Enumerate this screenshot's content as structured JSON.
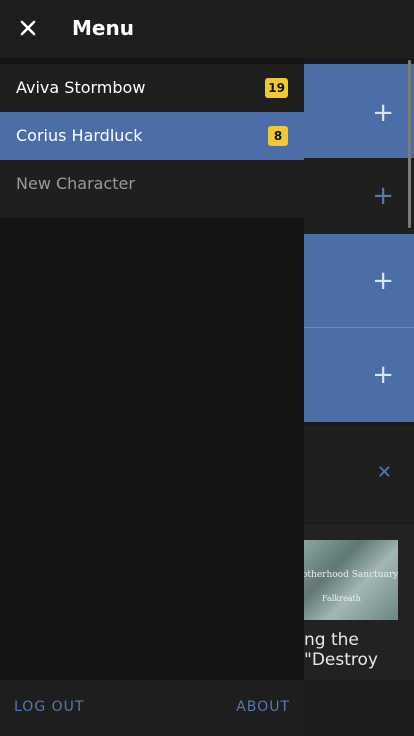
{
  "drawer": {
    "title": "Menu",
    "close_icon": "close-icon",
    "characters": [
      {
        "name": "Aviva Stormbow",
        "badge": "19",
        "selected": false
      },
      {
        "name": "Corius Hardluck",
        "badge": "8",
        "selected": true
      }
    ],
    "new_character_label": "New Character",
    "footer": {
      "logout_label": "LOG OUT",
      "about_label": "ABOUT"
    }
  },
  "background": {
    "map_title": "otherhood Sanctuary",
    "map_place": "Falkreath",
    "text_line1": "ng the",
    "text_line2": "\"Destroy",
    "add_icon": "plus-icon",
    "dismiss_icon": "close-icon"
  },
  "colors": {
    "accent_blue": "#4b6ea8",
    "badge_yellow": "#f2c832",
    "link_blue": "#5677b0",
    "drawer_bg": "#141414"
  }
}
